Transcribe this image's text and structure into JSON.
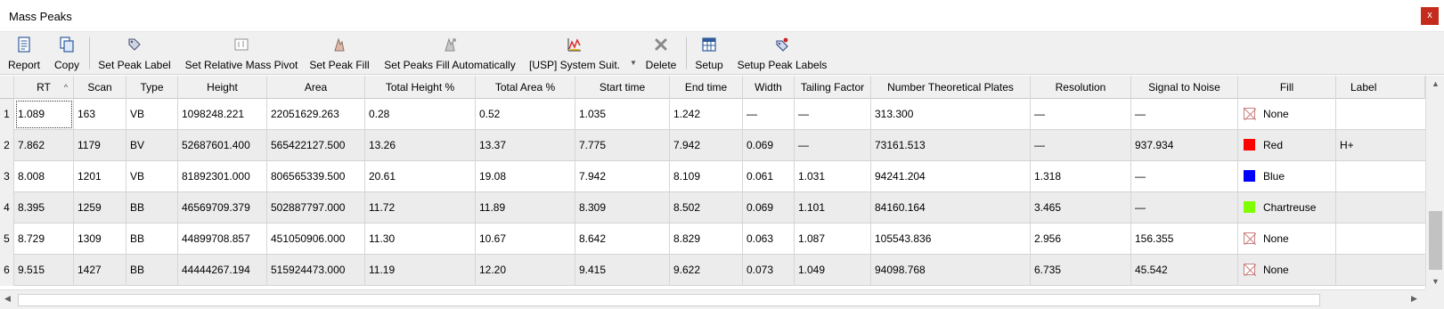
{
  "window": {
    "title": "Mass Peaks",
    "close_label": "x"
  },
  "toolbar": {
    "report": "Report",
    "copy": "Copy",
    "set_peak_label": "Set Peak Label",
    "set_relative_mass_pivot": "Set Relative Mass Pivot",
    "set_peak_fill": "Set Peak Fill",
    "set_peaks_fill_auto": "Set Peaks Fill Automatically",
    "system_suit": "[USP] System Suit.",
    "delete": "Delete",
    "setup": "Setup",
    "setup_peak_labels": "Setup Peak Labels"
  },
  "table": {
    "columns": [
      "RT",
      "Scan",
      "Type",
      "Height",
      "Area",
      "Total Height %",
      "Total Area %",
      "Start time",
      "End time",
      "Width",
      "Tailing Factor",
      "Number Theoretical Plates",
      "Resolution",
      "Signal to Noise",
      "Fill",
      "Label"
    ],
    "rows": [
      {
        "num": "1",
        "rt": "1.089",
        "scan": "163",
        "type": "VB",
        "height": "1098248.221",
        "area": "22051629.263",
        "total_height": "0.28",
        "total_area": "0.52",
        "start": "1.035",
        "end": "1.242",
        "width": "—",
        "tailing": "—",
        "plates": "313.300",
        "resolution": "—",
        "s2n": "—",
        "fill": "None",
        "fill_color": "none",
        "label": ""
      },
      {
        "num": "2",
        "rt": "7.862",
        "scan": "1179",
        "type": "BV",
        "height": "52687601.400",
        "area": "565422127.500",
        "total_height": "13.26",
        "total_area": "13.37",
        "start": "7.775",
        "end": "7.942",
        "width": "0.069",
        "tailing": "—",
        "plates": "73161.513",
        "resolution": "—",
        "s2n": "937.934",
        "fill": "Red",
        "fill_color": "#ff0000",
        "label": "H+"
      },
      {
        "num": "3",
        "rt": "8.008",
        "scan": "1201",
        "type": "VB",
        "height": "81892301.000",
        "area": "806565339.500",
        "total_height": "20.61",
        "total_area": "19.08",
        "start": "7.942",
        "end": "8.109",
        "width": "0.061",
        "tailing": "1.031",
        "plates": "94241.204",
        "resolution": "1.318",
        "s2n": "—",
        "fill": "Blue",
        "fill_color": "#0000ff",
        "label": ""
      },
      {
        "num": "4",
        "rt": "8.395",
        "scan": "1259",
        "type": "BB",
        "height": "46569709.379",
        "area": "502887797.000",
        "total_height": "11.72",
        "total_area": "11.89",
        "start": "8.309",
        "end": "8.502",
        "width": "0.069",
        "tailing": "1.101",
        "plates": "84160.164",
        "resolution": "3.465",
        "s2n": "—",
        "fill": "Chartreuse",
        "fill_color": "#7fff00",
        "label": ""
      },
      {
        "num": "5",
        "rt": "8.729",
        "scan": "1309",
        "type": "BB",
        "height": "44899708.857",
        "area": "451050906.000",
        "total_height": "11.30",
        "total_area": "10.67",
        "start": "8.642",
        "end": "8.829",
        "width": "0.063",
        "tailing": "1.087",
        "plates": "105543.836",
        "resolution": "2.956",
        "s2n": "156.355",
        "fill": "None",
        "fill_color": "none",
        "label": ""
      },
      {
        "num": "6",
        "rt": "9.515",
        "scan": "1427",
        "type": "BB",
        "height": "44444267.194",
        "area": "515924473.000",
        "total_height": "11.19",
        "total_area": "12.20",
        "start": "9.415",
        "end": "9.622",
        "width": "0.073",
        "tailing": "1.049",
        "plates": "94098.768",
        "resolution": "6.735",
        "s2n": "45.542",
        "fill": "None",
        "fill_color": "none",
        "label": ""
      }
    ]
  },
  "icons": {
    "report": "report-icon",
    "copy": "copy-icon",
    "set_peak_label": "tag-icon",
    "set_relative_mass_pivot": "pivot-icon",
    "set_peak_fill": "fill-icon",
    "set_peaks_fill_auto": "auto-fill-icon",
    "system_suit": "chart-icon",
    "delete": "delete-icon",
    "setup": "table-setup-icon",
    "setup_peak_labels": "label-setup-icon"
  },
  "colors": {
    "window_close": "#c42b1c",
    "toolbar_bg": "#f0f0f0",
    "row_alt": "#ececec"
  }
}
